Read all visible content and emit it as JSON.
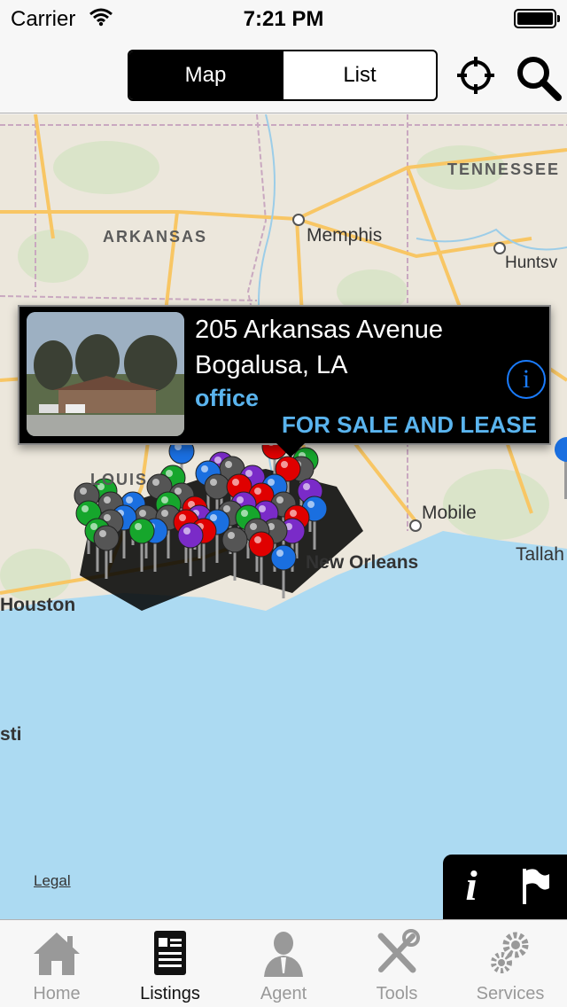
{
  "status_bar": {
    "carrier": "Carrier",
    "time": "7:21 PM"
  },
  "nav_bar": {
    "segments": [
      {
        "label": "Map",
        "selected": true
      },
      {
        "label": "List",
        "selected": false
      }
    ],
    "locate_icon": "crosshair-icon",
    "search_icon": "search-icon"
  },
  "map": {
    "labels": {
      "tennessee": "TENNESSEE",
      "arkansas": "ARKANSAS",
      "memphis": "Memphis",
      "huntsville": "Huntsv",
      "louisiana": "LOUIS",
      "mobile": "Mobile",
      "tallahassee": "Tallah",
      "new_orleans": "New Orleans",
      "houston": "Houston",
      "corpus": "sti"
    },
    "legal": "Legal",
    "colors": {
      "water": "#acdaf2",
      "land": "#ece7dc",
      "highway": "#f8c664",
      "pin_red": "#e00000",
      "pin_blue": "#1a6fe0",
      "pin_green": "#16a62c",
      "pin_purple": "#7a2bc8",
      "pin_gray": "#555555"
    }
  },
  "callout": {
    "address": "205 Arkansas Avenue",
    "city": "Bogalusa, LA",
    "type": "office",
    "status": "FOR SALE AND LEASE",
    "info_icon": "info-icon"
  },
  "map_tools": {
    "info_icon": "info-icon",
    "flag_icon": "flag-icon"
  },
  "tab_bar": {
    "tabs": [
      {
        "label": "Home",
        "icon": "house-icon",
        "active": false
      },
      {
        "label": "Listings",
        "icon": "listing-icon",
        "active": true
      },
      {
        "label": "Agent",
        "icon": "agent-icon",
        "active": false
      },
      {
        "label": "Tools",
        "icon": "tools-icon",
        "active": false
      },
      {
        "label": "Services",
        "icon": "gears-icon",
        "active": false
      }
    ]
  }
}
